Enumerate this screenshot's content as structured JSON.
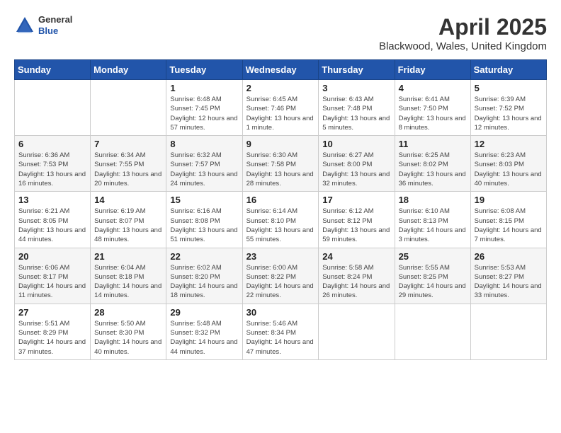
{
  "header": {
    "logo_general": "General",
    "logo_blue": "Blue",
    "month_title": "April 2025",
    "location": "Blackwood, Wales, United Kingdom"
  },
  "days_of_week": [
    "Sunday",
    "Monday",
    "Tuesday",
    "Wednesday",
    "Thursday",
    "Friday",
    "Saturday"
  ],
  "weeks": [
    [
      {
        "day": "",
        "text": ""
      },
      {
        "day": "",
        "text": ""
      },
      {
        "day": "1",
        "text": "Sunrise: 6:48 AM\nSunset: 7:45 PM\nDaylight: 12 hours and 57 minutes."
      },
      {
        "day": "2",
        "text": "Sunrise: 6:45 AM\nSunset: 7:46 PM\nDaylight: 13 hours and 1 minute."
      },
      {
        "day": "3",
        "text": "Sunrise: 6:43 AM\nSunset: 7:48 PM\nDaylight: 13 hours and 5 minutes."
      },
      {
        "day": "4",
        "text": "Sunrise: 6:41 AM\nSunset: 7:50 PM\nDaylight: 13 hours and 8 minutes."
      },
      {
        "day": "5",
        "text": "Sunrise: 6:39 AM\nSunset: 7:52 PM\nDaylight: 13 hours and 12 minutes."
      }
    ],
    [
      {
        "day": "6",
        "text": "Sunrise: 6:36 AM\nSunset: 7:53 PM\nDaylight: 13 hours and 16 minutes."
      },
      {
        "day": "7",
        "text": "Sunrise: 6:34 AM\nSunset: 7:55 PM\nDaylight: 13 hours and 20 minutes."
      },
      {
        "day": "8",
        "text": "Sunrise: 6:32 AM\nSunset: 7:57 PM\nDaylight: 13 hours and 24 minutes."
      },
      {
        "day": "9",
        "text": "Sunrise: 6:30 AM\nSunset: 7:58 PM\nDaylight: 13 hours and 28 minutes."
      },
      {
        "day": "10",
        "text": "Sunrise: 6:27 AM\nSunset: 8:00 PM\nDaylight: 13 hours and 32 minutes."
      },
      {
        "day": "11",
        "text": "Sunrise: 6:25 AM\nSunset: 8:02 PM\nDaylight: 13 hours and 36 minutes."
      },
      {
        "day": "12",
        "text": "Sunrise: 6:23 AM\nSunset: 8:03 PM\nDaylight: 13 hours and 40 minutes."
      }
    ],
    [
      {
        "day": "13",
        "text": "Sunrise: 6:21 AM\nSunset: 8:05 PM\nDaylight: 13 hours and 44 minutes."
      },
      {
        "day": "14",
        "text": "Sunrise: 6:19 AM\nSunset: 8:07 PM\nDaylight: 13 hours and 48 minutes."
      },
      {
        "day": "15",
        "text": "Sunrise: 6:16 AM\nSunset: 8:08 PM\nDaylight: 13 hours and 51 minutes."
      },
      {
        "day": "16",
        "text": "Sunrise: 6:14 AM\nSunset: 8:10 PM\nDaylight: 13 hours and 55 minutes."
      },
      {
        "day": "17",
        "text": "Sunrise: 6:12 AM\nSunset: 8:12 PM\nDaylight: 13 hours and 59 minutes."
      },
      {
        "day": "18",
        "text": "Sunrise: 6:10 AM\nSunset: 8:13 PM\nDaylight: 14 hours and 3 minutes."
      },
      {
        "day": "19",
        "text": "Sunrise: 6:08 AM\nSunset: 8:15 PM\nDaylight: 14 hours and 7 minutes."
      }
    ],
    [
      {
        "day": "20",
        "text": "Sunrise: 6:06 AM\nSunset: 8:17 PM\nDaylight: 14 hours and 11 minutes."
      },
      {
        "day": "21",
        "text": "Sunrise: 6:04 AM\nSunset: 8:18 PM\nDaylight: 14 hours and 14 minutes."
      },
      {
        "day": "22",
        "text": "Sunrise: 6:02 AM\nSunset: 8:20 PM\nDaylight: 14 hours and 18 minutes."
      },
      {
        "day": "23",
        "text": "Sunrise: 6:00 AM\nSunset: 8:22 PM\nDaylight: 14 hours and 22 minutes."
      },
      {
        "day": "24",
        "text": "Sunrise: 5:58 AM\nSunset: 8:24 PM\nDaylight: 14 hours and 26 minutes."
      },
      {
        "day": "25",
        "text": "Sunrise: 5:55 AM\nSunset: 8:25 PM\nDaylight: 14 hours and 29 minutes."
      },
      {
        "day": "26",
        "text": "Sunrise: 5:53 AM\nSunset: 8:27 PM\nDaylight: 14 hours and 33 minutes."
      }
    ],
    [
      {
        "day": "27",
        "text": "Sunrise: 5:51 AM\nSunset: 8:29 PM\nDaylight: 14 hours and 37 minutes."
      },
      {
        "day": "28",
        "text": "Sunrise: 5:50 AM\nSunset: 8:30 PM\nDaylight: 14 hours and 40 minutes."
      },
      {
        "day": "29",
        "text": "Sunrise: 5:48 AM\nSunset: 8:32 PM\nDaylight: 14 hours and 44 minutes."
      },
      {
        "day": "30",
        "text": "Sunrise: 5:46 AM\nSunset: 8:34 PM\nDaylight: 14 hours and 47 minutes."
      },
      {
        "day": "",
        "text": ""
      },
      {
        "day": "",
        "text": ""
      },
      {
        "day": "",
        "text": ""
      }
    ]
  ]
}
